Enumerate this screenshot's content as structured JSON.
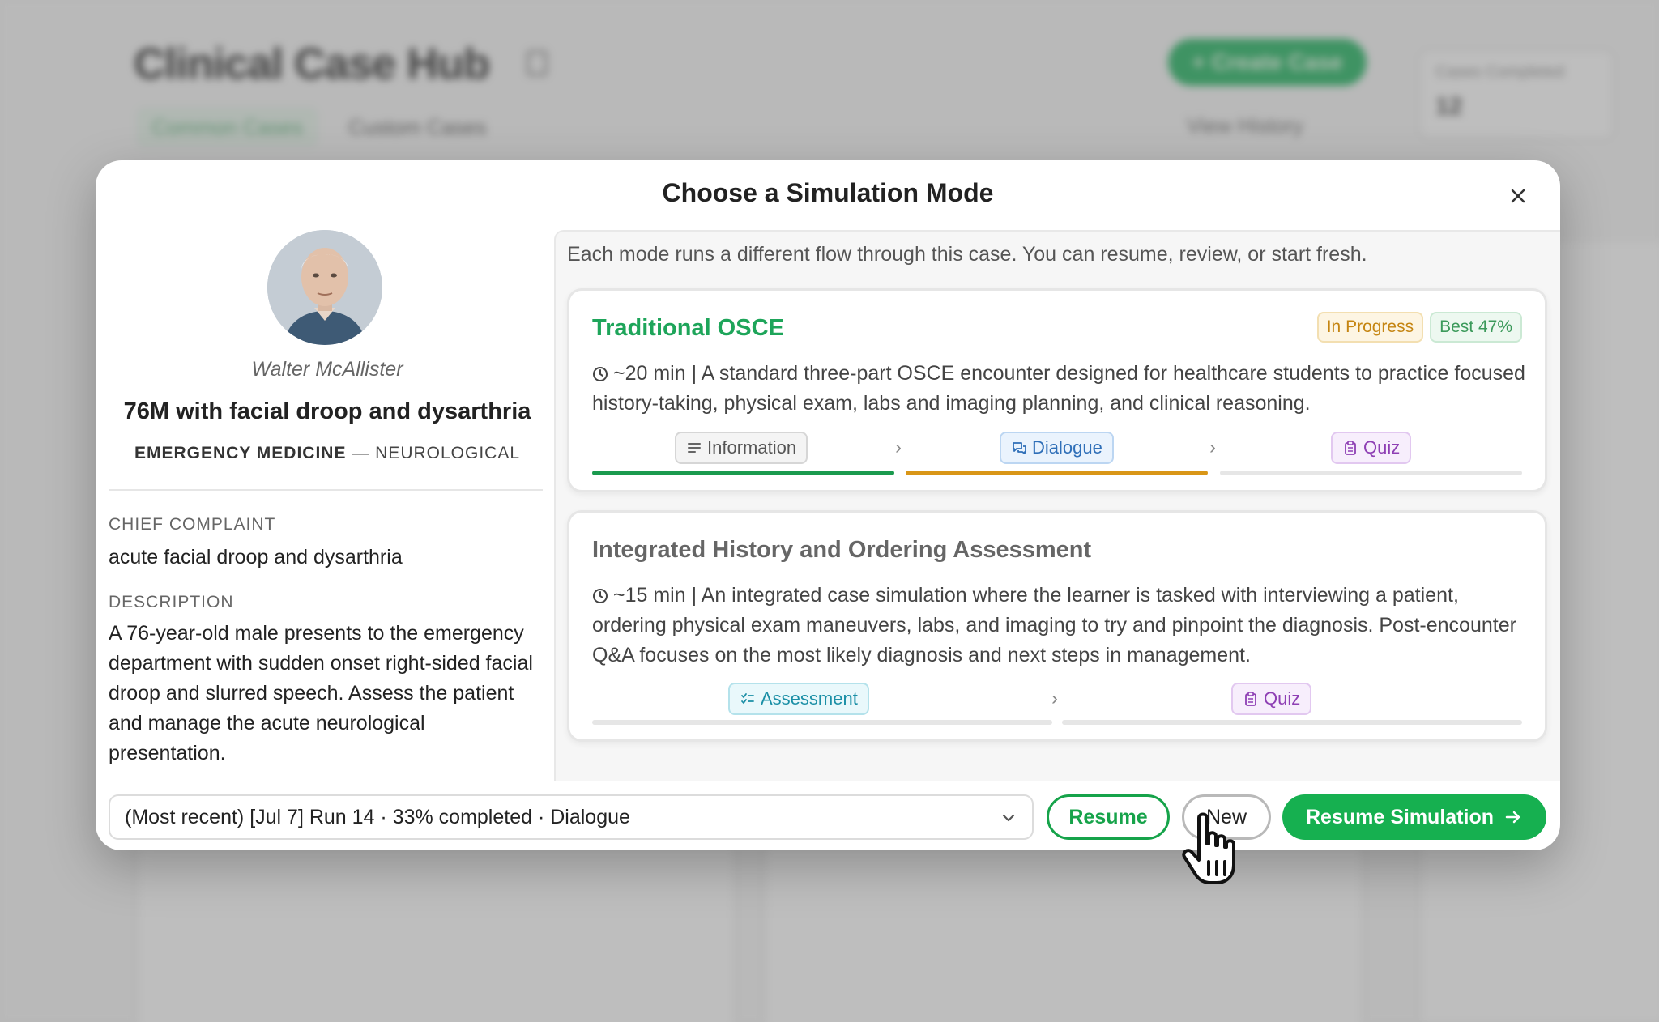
{
  "background": {
    "title": "Clinical Case Hub",
    "tabs": [
      "Common Cases",
      "Custom Cases"
    ],
    "create_button": "+ Create Case",
    "view_history": "View History",
    "stats_label": "Cases Completed",
    "stats_value": "12"
  },
  "modal": {
    "title": "Choose a Simulation Mode",
    "close_icon": "close-icon"
  },
  "patient": {
    "name": "Walter McAllister",
    "case_title": "76M with facial droop and dysarthria",
    "specialty": "EMERGENCY MEDICINE",
    "separator": "—",
    "subspecialty": "NEUROLOGICAL",
    "chief_complaint_label": "CHIEF COMPLAINT",
    "chief_complaint": "acute facial droop and dysarthria",
    "description_label": "DESCRIPTION",
    "description": "A 76-year-old male presents to the emergency department with sudden onset right-sided facial droop and slurred speech. Assess the patient and manage the acute neurological presentation."
  },
  "modes_intro": "Each mode runs a different flow through this case. You can resume, review, or start fresh.",
  "modes": [
    {
      "name": "Traditional OSCE",
      "name_color": "#1ea55a",
      "badges": [
        "In Progress",
        "Best 47%"
      ],
      "duration": "~20 min",
      "description": "A standard three-part OSCE encounter designed for healthcare students to practice focused history-taking, physical exam, labs and imaging planning, and clinical reasoning.",
      "steps": [
        "Information",
        "Dialogue",
        "Quiz"
      ],
      "step_colors": [
        "#1a9a4e",
        "#d99617",
        "#e6e6e6"
      ],
      "step_progress": [
        1,
        1,
        0
      ]
    },
    {
      "name": "Integrated History and Ordering Assessment",
      "name_color": "#666666",
      "duration": "~15 min",
      "description": "An integrated case simulation where the learner is tasked with interviewing a patient, ordering physical exam maneuvers, labs, and imaging to try and pinpoint the diagnosis. Post-encounter Q&A focuses on the most likely diagnosis and next steps in management.",
      "steps": [
        "Assessment",
        "Quiz"
      ],
      "step_progress": [
        0,
        0
      ]
    }
  ],
  "footer": {
    "selected_run": "(Most recent) [Jul 7] Run 14 · 33% completed · Dialogue",
    "resume_label": "Resume",
    "new_label": "New",
    "primary_label": "Resume Simulation"
  },
  "colors": {
    "accent": "#16b050",
    "in_progress": "#c58512",
    "best": "#3c9a5b"
  }
}
